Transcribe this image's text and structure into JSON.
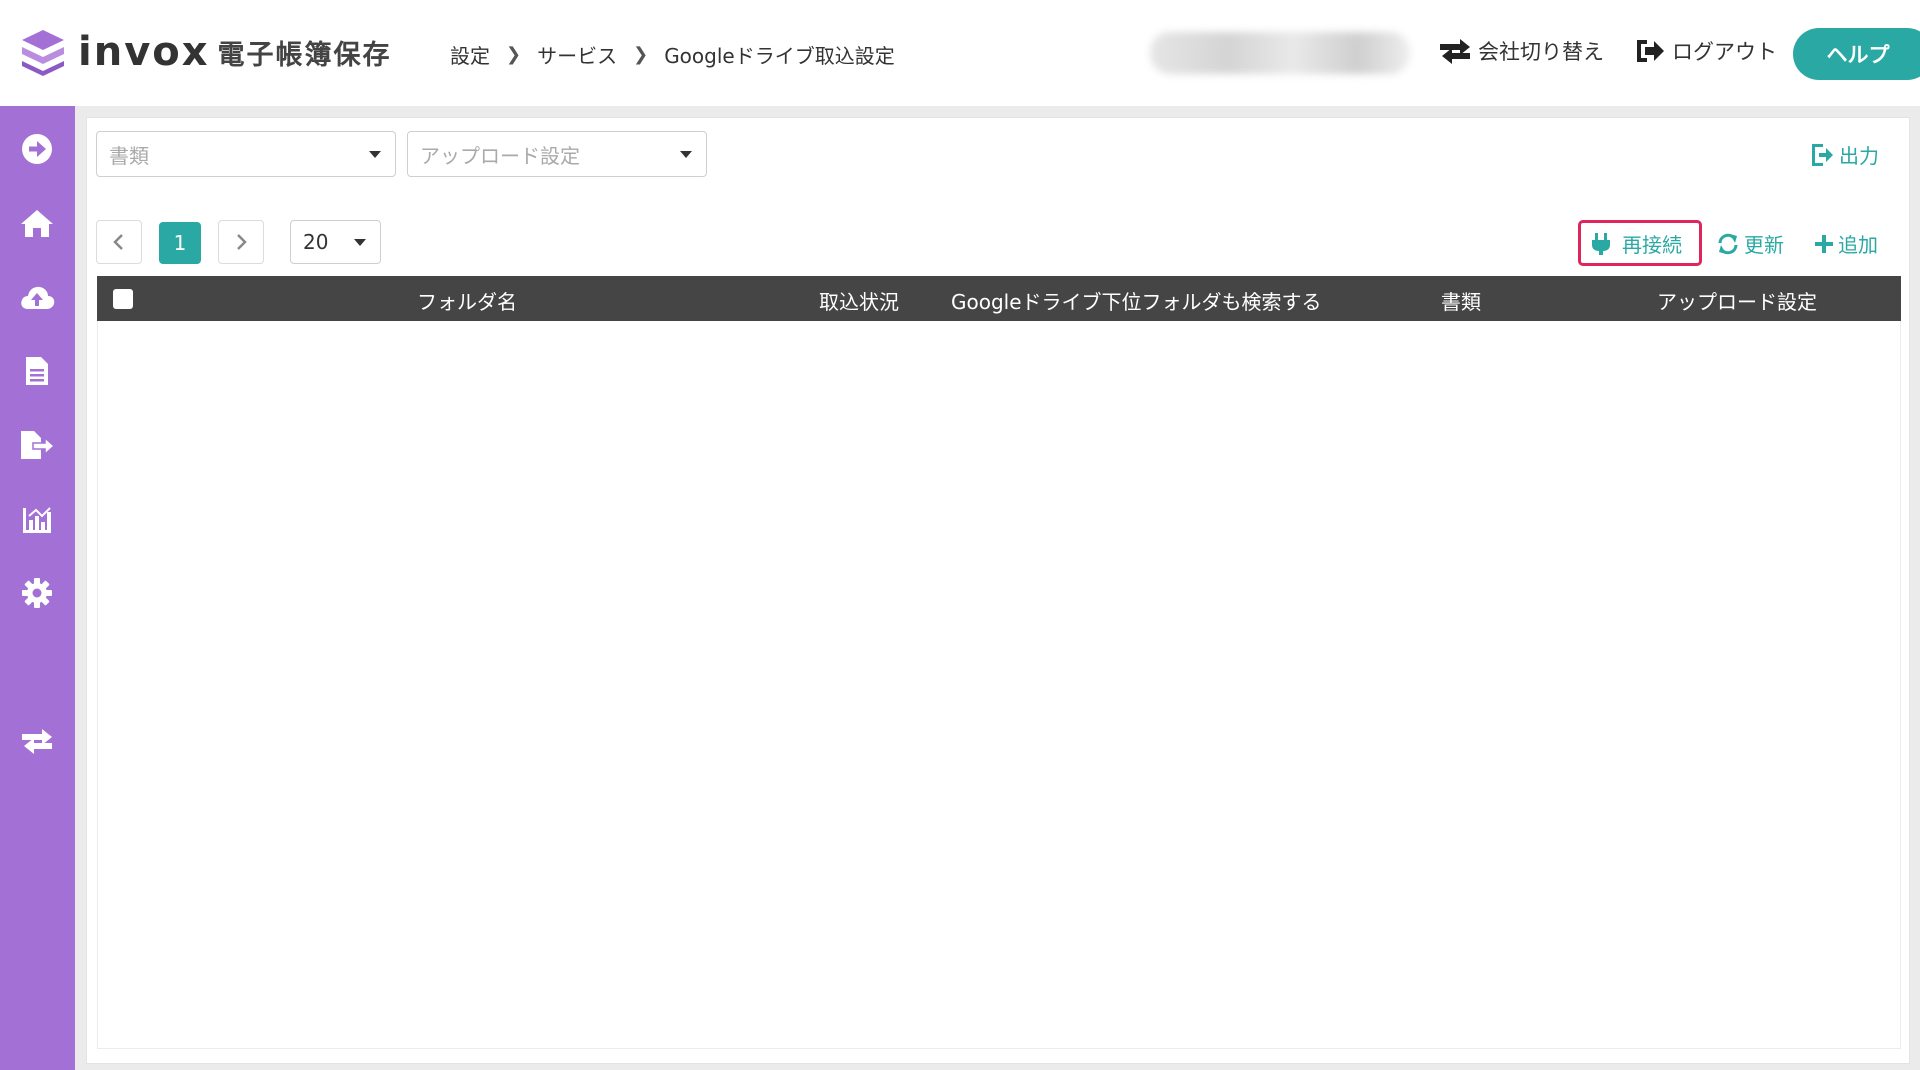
{
  "header": {
    "logo_text": "invox",
    "logo_subtitle": "電子帳簿保存",
    "breadcrumb": [
      "設定",
      "サービス",
      "Googleドライブ取込設定"
    ],
    "switch_company_label": "会社切り替え",
    "logout_label": "ログアウト",
    "help_label": "ヘルプ"
  },
  "sidebar": {
    "items": [
      {
        "icon": "arrow-circle-right-icon"
      },
      {
        "icon": "home-icon"
      },
      {
        "icon": "cloud-upload-icon"
      },
      {
        "icon": "document-icon"
      },
      {
        "icon": "file-export-icon"
      },
      {
        "icon": "chart-icon"
      },
      {
        "icon": "gear-icon"
      },
      {
        "icon": "switch-icon"
      }
    ]
  },
  "filters": {
    "document_placeholder": "書類",
    "upload_setting_placeholder": "アップロード設定",
    "export_label": "出力"
  },
  "pager": {
    "current_page": "1",
    "per_page": "20"
  },
  "actions": {
    "reconnect_label": "再接続",
    "refresh_label": "更新",
    "add_label": "追加"
  },
  "table": {
    "columns": [
      "フォルダ名",
      "取込状況",
      "Googleドライブ下位フォルダも検索する",
      "書類",
      "アップロード設定"
    ],
    "rows": []
  },
  "colors": {
    "accent": "#2aa9a4",
    "sidebar": "#a371d6",
    "table_header": "#454545",
    "highlight": "#e0245e"
  }
}
